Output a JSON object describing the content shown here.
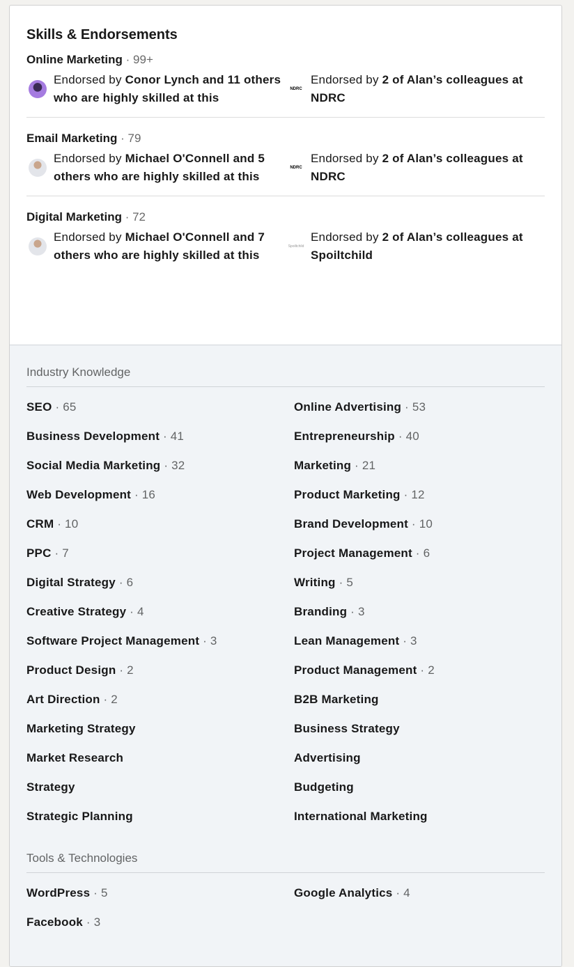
{
  "title": "Skills & Endorsements",
  "featured": [
    {
      "name": "Online Marketing",
      "count": "99+",
      "left": {
        "avatar": "avatar-conor-lynch",
        "prefix": "Endorsed by ",
        "bold": "Conor Lynch and 11 others who are highly skilled at this"
      },
      "right": {
        "logo": "NDRC",
        "prefix": "Endorsed by ",
        "bold": "2 of Alan’s colleagues at NDRC"
      }
    },
    {
      "name": "Email Marketing",
      "count": "79",
      "left": {
        "avatar": "avatar-michael-oconnell",
        "prefix": "Endorsed by ",
        "bold": "Michael O'Connell and 5 others who are highly skilled at this"
      },
      "right": {
        "logo": "NDRC",
        "prefix": "Endorsed by ",
        "bold": "2 of Alan’s colleagues at NDRC"
      }
    },
    {
      "name": "Digital Marketing",
      "count": "72",
      "left": {
        "avatar": "avatar-michael-oconnell",
        "prefix": "Endorsed by ",
        "bold": "Michael O'Connell and 7 others who are highly skilled at this"
      },
      "right": {
        "logo": "Spoiltchild",
        "prefix": "Endorsed by ",
        "bold": "2 of Alan’s colleagues at Spoiltchild"
      }
    }
  ],
  "categories": [
    {
      "title": "Industry Knowledge",
      "items": [
        {
          "name": "SEO",
          "count": "65"
        },
        {
          "name": "Online Advertising",
          "count": "53"
        },
        {
          "name": "Business Development",
          "count": "41"
        },
        {
          "name": "Entrepreneurship",
          "count": "40"
        },
        {
          "name": "Social Media Marketing",
          "count": "32"
        },
        {
          "name": "Marketing",
          "count": "21"
        },
        {
          "name": "Web Development",
          "count": "16"
        },
        {
          "name": "Product Marketing",
          "count": "12"
        },
        {
          "name": "CRM",
          "count": "10"
        },
        {
          "name": "Brand Development",
          "count": "10"
        },
        {
          "name": "PPC",
          "count": "7"
        },
        {
          "name": "Project Management",
          "count": "6"
        },
        {
          "name": "Digital Strategy",
          "count": "6"
        },
        {
          "name": "Writing",
          "count": "5"
        },
        {
          "name": "Creative Strategy",
          "count": "4"
        },
        {
          "name": "Branding",
          "count": "3"
        },
        {
          "name": "Software Project Management",
          "count": "3"
        },
        {
          "name": "Lean Management",
          "count": "3"
        },
        {
          "name": "Product Design",
          "count": "2"
        },
        {
          "name": "Product Management",
          "count": "2"
        },
        {
          "name": "Art Direction",
          "count": "2"
        },
        {
          "name": "B2B Marketing",
          "count": ""
        },
        {
          "name": "Marketing Strategy",
          "count": ""
        },
        {
          "name": "Business Strategy",
          "count": ""
        },
        {
          "name": "Market Research",
          "count": ""
        },
        {
          "name": "Advertising",
          "count": ""
        },
        {
          "name": "Strategy",
          "count": ""
        },
        {
          "name": "Budgeting",
          "count": ""
        },
        {
          "name": "Strategic Planning",
          "count": ""
        },
        {
          "name": "International Marketing",
          "count": ""
        }
      ]
    },
    {
      "title": "Tools & Technologies",
      "items": [
        {
          "name": "WordPress",
          "count": "5"
        },
        {
          "name": "Google Analytics",
          "count": "4"
        },
        {
          "name": "Facebook",
          "count": "3"
        }
      ]
    }
  ]
}
